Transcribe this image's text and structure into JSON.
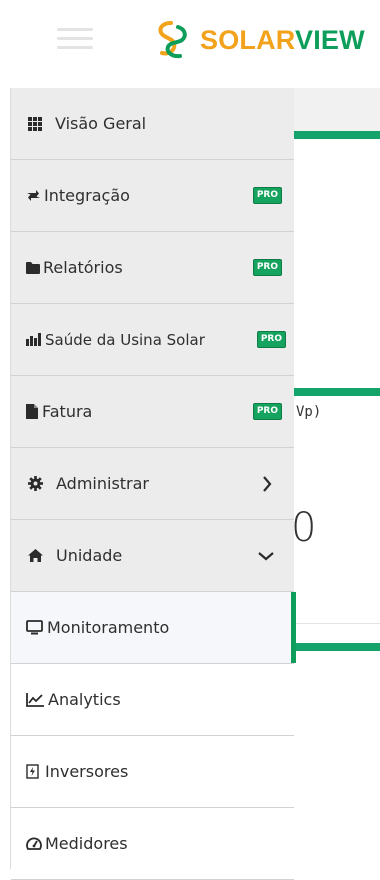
{
  "brand": {
    "name_part1": "SOLAR",
    "name_part2": "VIEW",
    "color_orange": "#f2a21b",
    "color_green": "#0c9e5a"
  },
  "background": {
    "unit_fragment": "Vp)",
    "value_fragment": "0"
  },
  "sidebar": {
    "items": [
      {
        "label": "Visão Geral",
        "icon": "grid-icon"
      },
      {
        "label": "Integração",
        "icon": "exchange-icon",
        "badge": "PRO"
      },
      {
        "label": "Relatórios",
        "icon": "folder-icon",
        "badge": "PRO"
      },
      {
        "label": "Saúde da Usina Solar",
        "icon": "health-chart-icon",
        "badge": "PRO"
      },
      {
        "label": "Fatura",
        "icon": "file-icon",
        "badge": "PRO"
      },
      {
        "label": "Administrar",
        "icon": "gear-icon",
        "chevron": "right"
      },
      {
        "label": "Unidade",
        "icon": "home-icon",
        "chevron": "down"
      },
      {
        "label": "Monitoramento",
        "icon": "monitor-icon",
        "active": true
      },
      {
        "label": "Analytics",
        "icon": "line-chart-icon"
      },
      {
        "label": "Inversores",
        "icon": "inverter-icon"
      },
      {
        "label": "Medidores",
        "icon": "gauge-icon"
      }
    ]
  }
}
